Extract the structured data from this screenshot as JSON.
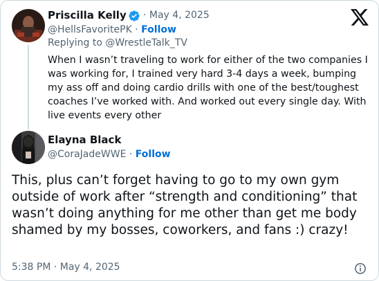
{
  "parent_tweet": {
    "author_name": "Priscilla Kelly",
    "date": "· May 4, 2025",
    "handle": "@HellsFavoritePK",
    "separator": "·",
    "follow_label": "Follow",
    "replying_to_prefix": "Replying to",
    "replying_to_handle": "@WrestleTalk_TV",
    "text": "When I wasn’t traveling to work for either of the two companies I was working for, I trained very hard 3-4 days a week, bumping my ass off and doing cardio drills with one of the best/toughest coaches I’ve worked with. And worked out every single day. With live events every other"
  },
  "main_tweet": {
    "author_name": "Elayna Black",
    "handle": "@CoraJadeWWE",
    "separator": "·",
    "follow_label": "Follow",
    "text": "This, plus can’t forget having to go to my own gym outside of work after “strength and conditioning” that wasn’t doing anything for me other than get me body shamed by my bosses, coworkers, and fans :) crazy!",
    "timestamp": "5:38 PM · May 4, 2025"
  },
  "icons": {
    "logo": "x-logo-icon",
    "verified": "verified-badge-icon",
    "info": "info-icon"
  },
  "colors": {
    "link": "#006fd6",
    "verified": "#1d9bf0",
    "muted": "#536471",
    "border": "#cfd9de"
  }
}
